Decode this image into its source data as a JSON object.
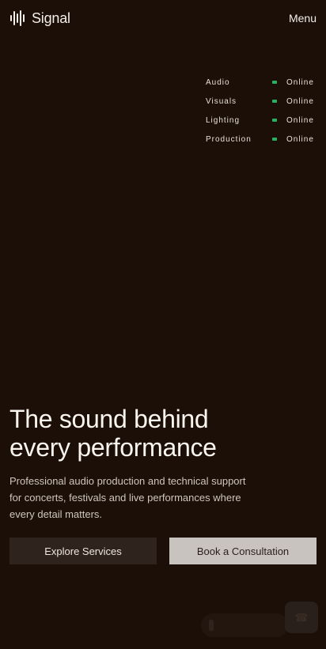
{
  "header": {
    "brand_name": "Signal",
    "brand_icon": "waveform-icon",
    "menu_label": "Menu"
  },
  "status": {
    "rows": [
      {
        "label": "Audio",
        "value": "Online"
      },
      {
        "label": "Visuals",
        "value": "Online"
      },
      {
        "label": "Lighting",
        "value": "Online"
      },
      {
        "label": "Production",
        "value": "Online"
      }
    ],
    "online_color": "#2fae5f"
  },
  "hero": {
    "title_line1": "The sound behind",
    "title_line2": "every performance",
    "subtitle": "Professional audio production and technical support for concerts, festivals and live performances where every detail matters."
  },
  "actions": {
    "primary_label": "Explore Services",
    "secondary_label": "Book a Consultation"
  },
  "floating": {
    "pill_icon": "phone-icon",
    "call_icon": "phone-icon"
  }
}
